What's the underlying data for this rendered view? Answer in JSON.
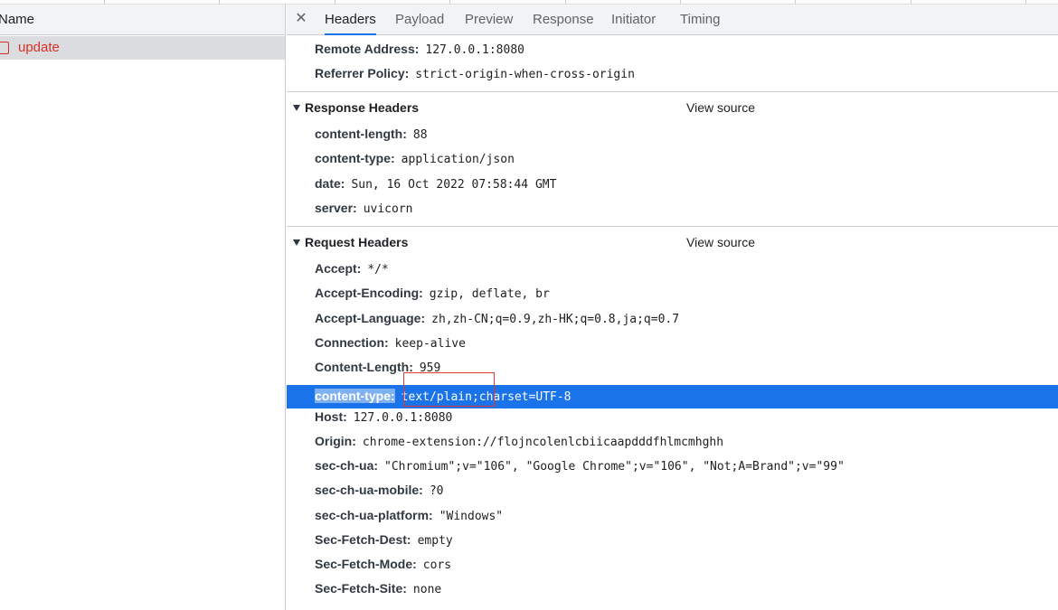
{
  "network_list": {
    "column_header": "Name",
    "requests": [
      {
        "name": "update"
      }
    ]
  },
  "tabs": [
    "Headers",
    "Payload",
    "Preview",
    "Response",
    "Initiator",
    "Timing"
  ],
  "active_tab": "Headers",
  "general_partial": [
    {
      "key": "Remote Address:",
      "value": "127.0.0.1:8080"
    },
    {
      "key": "Referrer Policy:",
      "value": "strict-origin-when-cross-origin"
    }
  ],
  "response_headers": {
    "title": "Response Headers",
    "view_source": "View source",
    "rows": [
      {
        "key": "content-length:",
        "value": "88"
      },
      {
        "key": "content-type:",
        "value": "application/json"
      },
      {
        "key": "date:",
        "value": "Sun, 16 Oct 2022 07:58:44 GMT"
      },
      {
        "key": "server:",
        "value": "uvicorn"
      }
    ]
  },
  "request_headers": {
    "title": "Request Headers",
    "view_source": "View source",
    "rows": [
      {
        "key": "Accept:",
        "value": "*/*"
      },
      {
        "key": "Accept-Encoding:",
        "value": "gzip, deflate, br"
      },
      {
        "key": "Accept-Language:",
        "value": "zh,zh-CN;q=0.9,zh-HK;q=0.8,ja;q=0.7"
      },
      {
        "key": "Connection:",
        "value": "keep-alive"
      },
      {
        "key": "Content-Length:",
        "value": "959"
      },
      {
        "key": "content-type:",
        "value": "text/plain;charset=UTF-8"
      },
      {
        "key": "Host:",
        "value": "127.0.0.1:8080"
      },
      {
        "key": "Origin:",
        "value": "chrome-extension://flojncolenlcbiicaapdddfhlmcmhghh"
      },
      {
        "key": "sec-ch-ua:",
        "value": "\"Chromium\";v=\"106\", \"Google Chrome\";v=\"106\", \"Not;A=Brand\";v=\"99\""
      },
      {
        "key": "sec-ch-ua-mobile:",
        "value": "?0"
      },
      {
        "key": "sec-ch-ua-platform:",
        "value": "\"Windows\""
      },
      {
        "key": "Sec-Fetch-Dest:",
        "value": "empty"
      },
      {
        "key": "Sec-Fetch-Mode:",
        "value": "cors"
      },
      {
        "key": "Sec-Fetch-Site:",
        "value": "none"
      }
    ]
  },
  "icons": {
    "close": "close-icon",
    "section_toggle": "triangle-down-icon",
    "request_file": "document-icon"
  },
  "colors": {
    "accent": "#1a73e8",
    "error_request": "#d93025",
    "annotation_box": "#e53935"
  }
}
